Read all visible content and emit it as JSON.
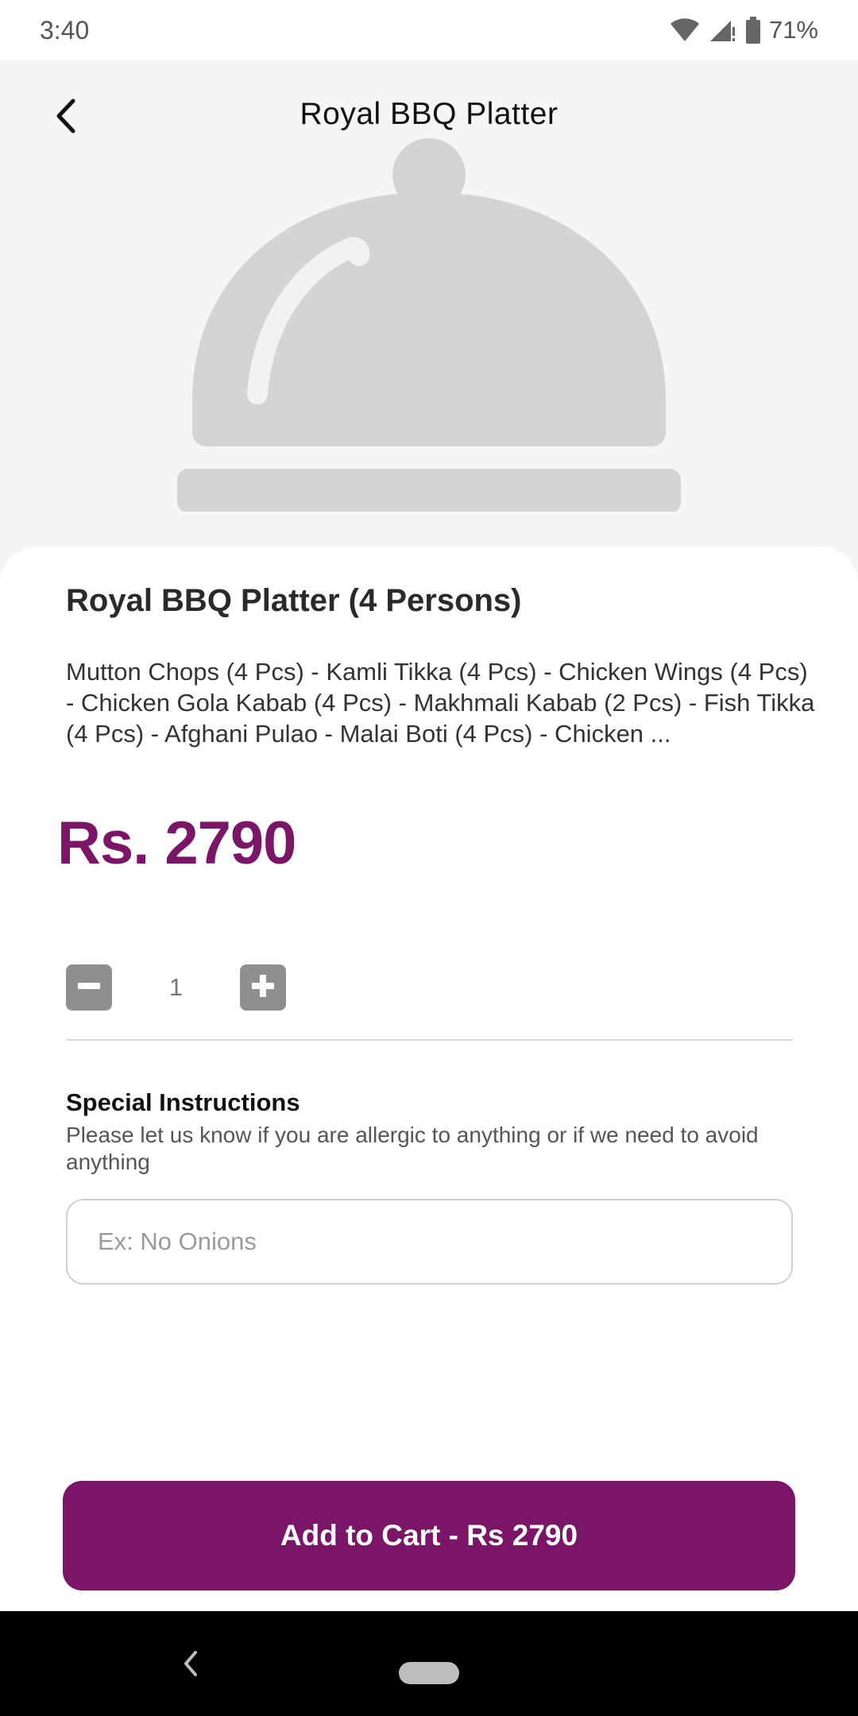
{
  "status_bar": {
    "time": "3:40",
    "battery": "71%",
    "icons": [
      "wifi-icon",
      "signal-icon",
      "battery-icon"
    ]
  },
  "header": {
    "title": "Royal BBQ Platter",
    "back_icon": "chevron-left-icon"
  },
  "hero": {
    "image_icon": "food-cloche-icon"
  },
  "item": {
    "name": "Royal BBQ Platter (4 Persons)",
    "description": "Mutton Chops (4 Pcs) - Kamli Tikka (4 Pcs) - Chicken Wings (4 Pcs) - Chicken Gola Kabab (4 Pcs) - Makhmali Kabab (2 Pcs) - Fish Tikka (4 Pcs) - Afghani Pulao - Malai Boti (4 Pcs) - Chicken ...",
    "price": "Rs. 2790"
  },
  "quantity": {
    "value": "1",
    "decrement_icon": "minus-icon",
    "increment_icon": "plus-icon"
  },
  "special_instructions": {
    "title": "Special Instructions",
    "subtitle": "Please let us know if you are allergic to anything or if we need to avoid anything",
    "input_value": "",
    "placeholder": "Ex: No Onions"
  },
  "cart_button": {
    "label": "Add to Cart - Rs 2790"
  },
  "colors": {
    "accent": "#7b1567",
    "hero_bg": "#f5f5f5",
    "qty_button": "#8f8f8f"
  }
}
